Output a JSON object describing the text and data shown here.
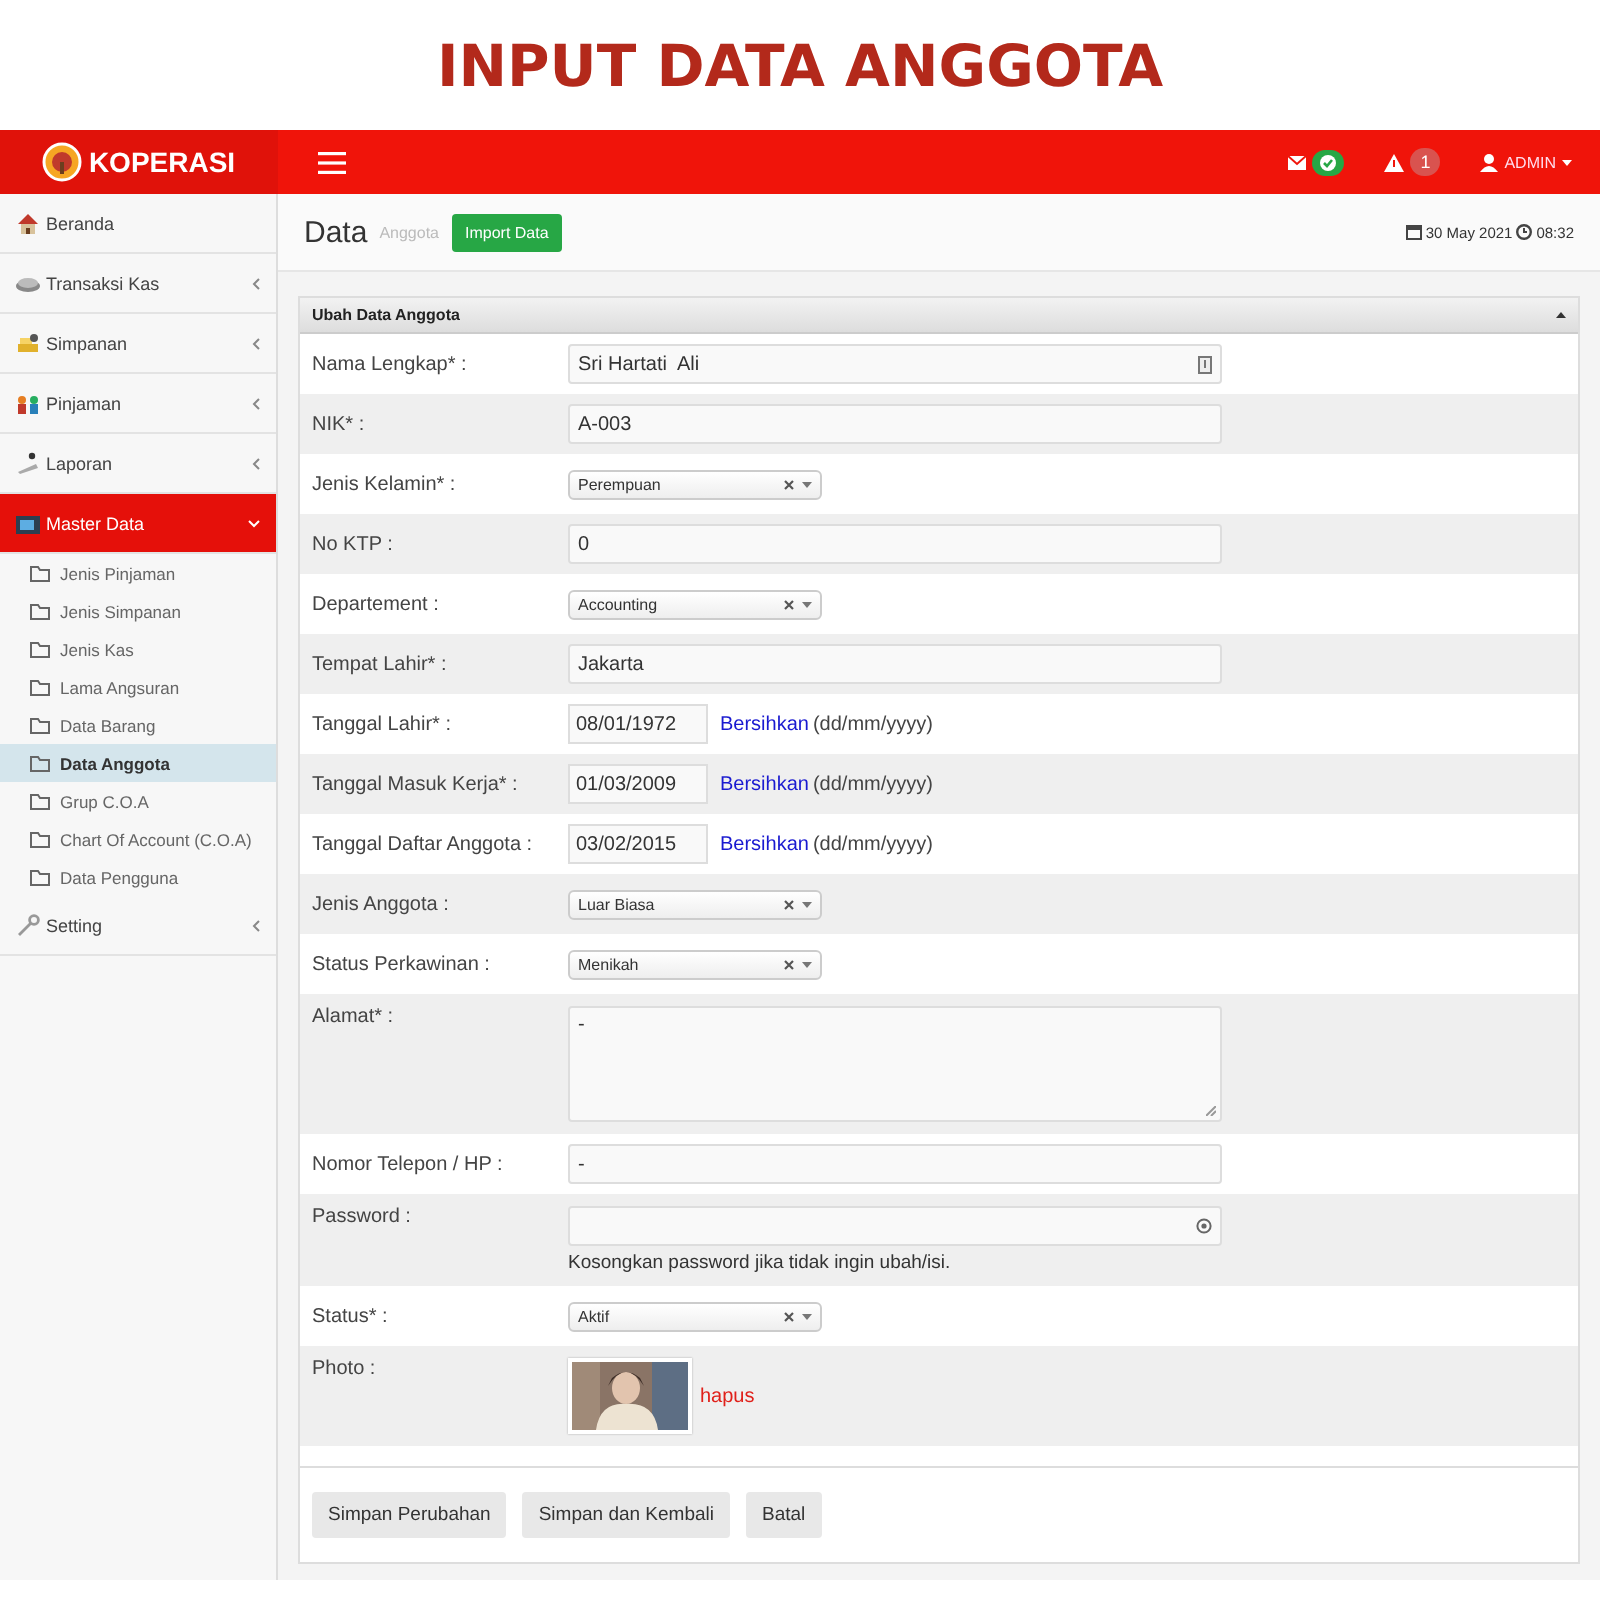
{
  "banner": {
    "title": "INPUT DATA ANGGOTA"
  },
  "header": {
    "brand": "KOPERASI",
    "alert_count": "1",
    "user": "ADMIN"
  },
  "sidebar": {
    "items": [
      {
        "label": "Beranda",
        "kind": "link",
        "selected": false
      },
      {
        "label": "Transaksi Kas",
        "kind": "menu",
        "selected": false,
        "expanded": false
      },
      {
        "label": "Simpanan",
        "kind": "menu",
        "selected": false,
        "expanded": false
      },
      {
        "label": "Pinjaman",
        "kind": "menu",
        "selected": false,
        "expanded": false
      },
      {
        "label": "Laporan",
        "kind": "menu",
        "selected": false,
        "expanded": false
      },
      {
        "label": "Master Data",
        "kind": "menu",
        "selected": true,
        "expanded": true,
        "children": [
          {
            "label": "Jenis Pinjaman",
            "selected": false
          },
          {
            "label": "Jenis Simpanan",
            "selected": false
          },
          {
            "label": "Jenis Kas",
            "selected": false
          },
          {
            "label": "Lama Angsuran",
            "selected": false
          },
          {
            "label": "Data Barang",
            "selected": false
          },
          {
            "label": "Data Anggota",
            "selected": true
          },
          {
            "label": "Grup C.O.A",
            "selected": false
          },
          {
            "label": "Chart Of Account (C.O.A)",
            "selected": false
          },
          {
            "label": "Data Pengguna",
            "selected": false
          }
        ]
      },
      {
        "label": "Setting",
        "kind": "menu",
        "selected": false,
        "expanded": false
      }
    ]
  },
  "page": {
    "title": "Data",
    "subtitle": "Anggota",
    "import_button": "Import Data",
    "date": "30 May 2021",
    "time": "08:32"
  },
  "form": {
    "title": "Ubah Data Anggota",
    "rows": [
      {
        "kind": "text",
        "label": "Nama Lengkap* :",
        "value": "Sri Hartati  Ali",
        "has_icon": true
      },
      {
        "kind": "text",
        "label": "NIK* :",
        "value": "A-003"
      },
      {
        "kind": "select",
        "label": "Jenis Kelamin* :",
        "value": "Perempuan"
      },
      {
        "kind": "text",
        "label": "No KTP :",
        "value": "0"
      },
      {
        "kind": "select",
        "label": "Departement :",
        "value": "Accounting"
      },
      {
        "kind": "text",
        "label": "Tempat Lahir* :",
        "value": "Jakarta"
      },
      {
        "kind": "date",
        "label": "Tanggal Lahir* :",
        "value": "08/01/1972",
        "link": "Bersihkan",
        "hint": "(dd/mm/yyyy)"
      },
      {
        "kind": "date",
        "label": "Tanggal Masuk Kerja* :",
        "value": "01/03/2009",
        "link": "Bersihkan",
        "hint": "(dd/mm/yyyy)"
      },
      {
        "kind": "date",
        "label": "Tanggal Daftar Anggota :",
        "value": "03/02/2015",
        "link": "Bersihkan",
        "hint": "(dd/mm/yyyy)"
      },
      {
        "kind": "select",
        "label": "Jenis Anggota :",
        "value": "Luar Biasa"
      },
      {
        "kind": "select",
        "label": "Status Perkawinan :",
        "value": "Menikah"
      },
      {
        "kind": "textarea",
        "label": "Alamat* :",
        "value": "-"
      },
      {
        "kind": "text",
        "label": "Nomor Telepon / HP :",
        "value": "-"
      },
      {
        "kind": "password",
        "label": "Password :",
        "help": "Kosongkan password jika tidak ingin ubah/isi."
      },
      {
        "kind": "select",
        "label": "Status* :",
        "value": "Aktif"
      },
      {
        "label": "Photo :",
        "link": "hapus"
      }
    ],
    "buttons": [
      "Simpan Perubahan",
      "Simpan dan Kembali",
      "Batal"
    ]
  }
}
